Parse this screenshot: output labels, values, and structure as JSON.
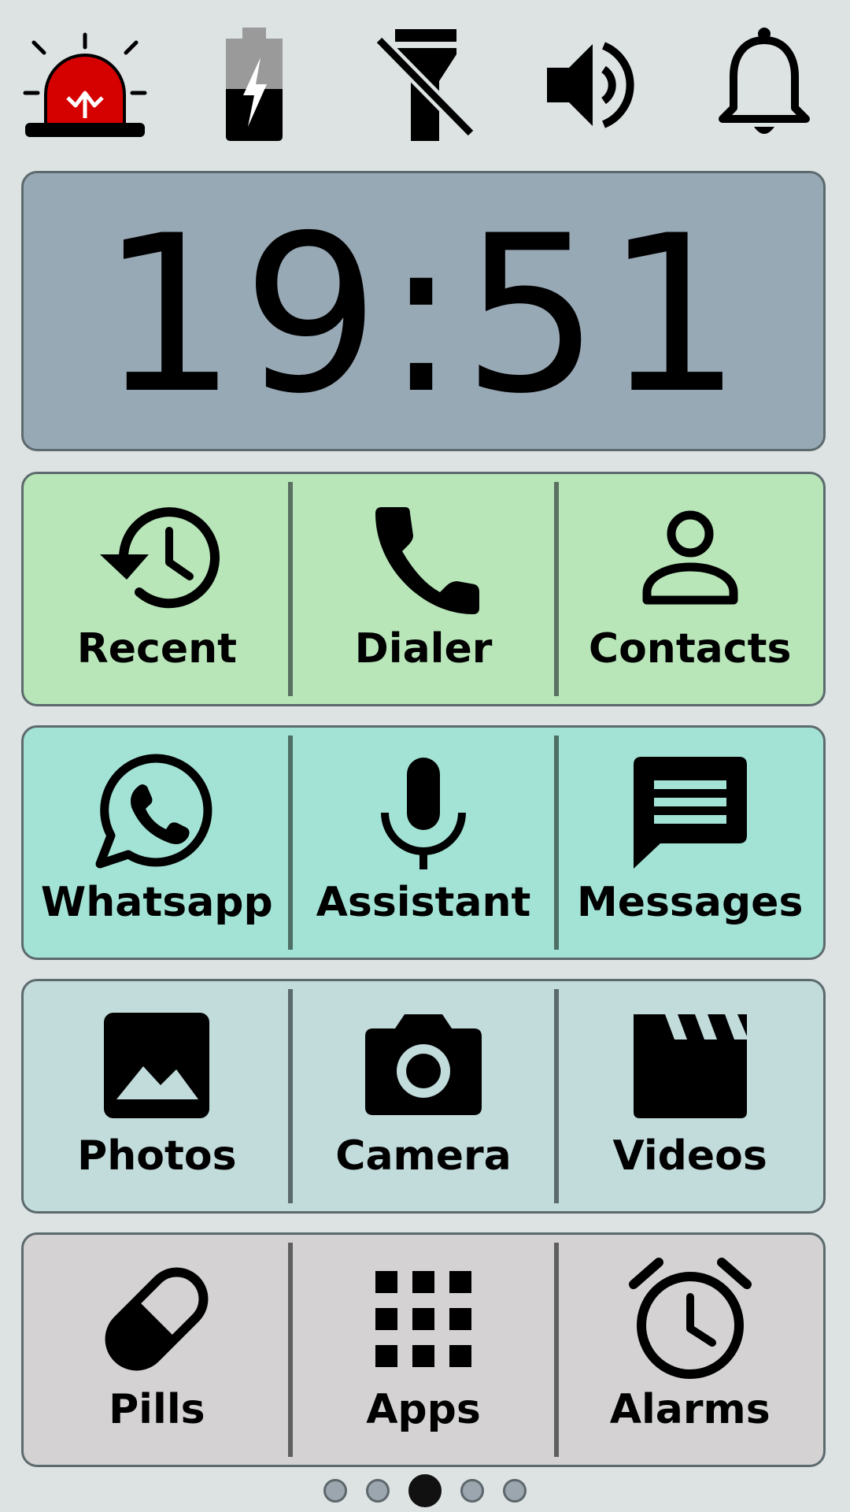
{
  "top_bar": {
    "items": [
      {
        "icon": "sos-alarm-icon",
        "color": "#d50000"
      },
      {
        "icon": "battery-charging-icon"
      },
      {
        "icon": "flashlight-off-icon"
      },
      {
        "icon": "volume-icon"
      },
      {
        "icon": "bell-icon"
      }
    ]
  },
  "clock": {
    "time": "19:51",
    "background": "#98a9b6"
  },
  "rows": {
    "communication": {
      "color": "#b8e6b9",
      "tiles": [
        {
          "label": "Recent",
          "icon": "history-icon"
        },
        {
          "label": "Dialer",
          "icon": "phone-icon"
        },
        {
          "label": "Contacts",
          "icon": "person-icon"
        }
      ]
    },
    "chat": {
      "color": "#a3e3d6",
      "tiles": [
        {
          "label": "Whatsapp",
          "icon": "whatsapp-icon"
        },
        {
          "label": "Assistant",
          "icon": "microphone-icon"
        },
        {
          "label": "Messages",
          "icon": "message-icon"
        }
      ]
    },
    "media": {
      "color": "#c2dbdb",
      "tiles": [
        {
          "label": "Photos",
          "icon": "image-icon"
        },
        {
          "label": "Camera",
          "icon": "camera-icon"
        },
        {
          "label": "Videos",
          "icon": "clapperboard-icon"
        }
      ]
    },
    "tools": {
      "color": "#d4d2d2",
      "tiles": [
        {
          "label": "Pills",
          "icon": "pill-icon"
        },
        {
          "label": "Apps",
          "icon": "apps-grid-icon"
        },
        {
          "label": "Alarms",
          "icon": "alarm-clock-icon"
        }
      ]
    }
  },
  "pager": {
    "page_count": 5,
    "current_page": 3
  }
}
